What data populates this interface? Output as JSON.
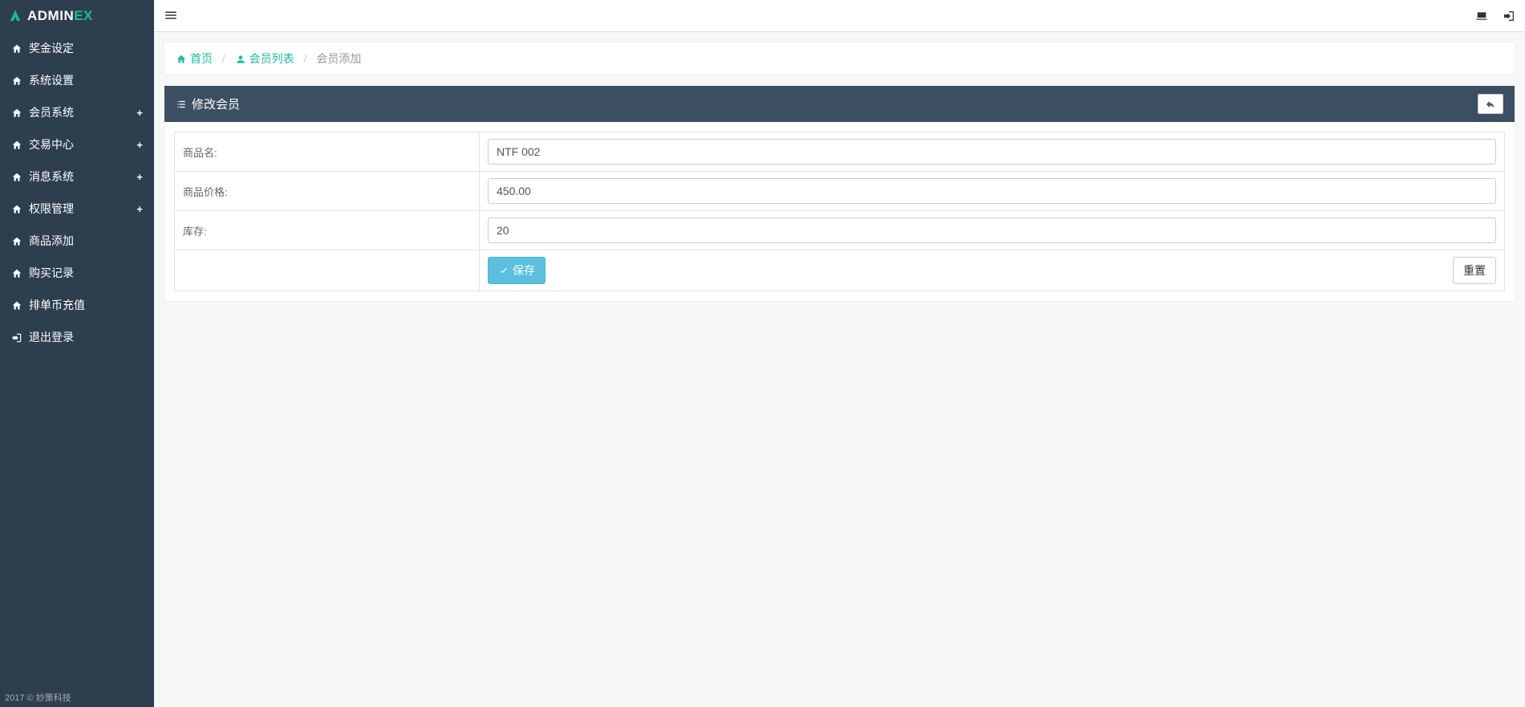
{
  "brand": {
    "name_prefix": "ADMIN",
    "name_suffix": "EX"
  },
  "sidebar": {
    "items": [
      {
        "icon": "home",
        "label": "奖金设定",
        "expandable": false
      },
      {
        "icon": "home",
        "label": "系统设置",
        "expandable": false
      },
      {
        "icon": "home",
        "label": "会员系统",
        "expandable": true
      },
      {
        "icon": "home",
        "label": "交易中心",
        "expandable": true
      },
      {
        "icon": "home",
        "label": "消息系统",
        "expandable": true
      },
      {
        "icon": "home",
        "label": "权限管理",
        "expandable": true
      },
      {
        "icon": "home",
        "label": "商品添加",
        "expandable": false
      },
      {
        "icon": "home",
        "label": "购买记录",
        "expandable": false
      },
      {
        "icon": "home",
        "label": "排单币充值",
        "expandable": false
      },
      {
        "icon": "signout",
        "label": "退出登录",
        "expandable": false
      }
    ]
  },
  "breadcrumb": {
    "home": "首页",
    "list": "会员列表",
    "current": "会员添加"
  },
  "panel": {
    "title": "修改会员"
  },
  "form": {
    "fields": {
      "product_name": {
        "label": "商品名:",
        "value": "NTF 002"
      },
      "product_price": {
        "label": "商品价格:",
        "value": "450.00"
      },
      "stock": {
        "label": "库存:",
        "value": "20"
      }
    },
    "buttons": {
      "save": "保存",
      "reset": "重置"
    }
  },
  "footer": "2017 © 妙策科技"
}
